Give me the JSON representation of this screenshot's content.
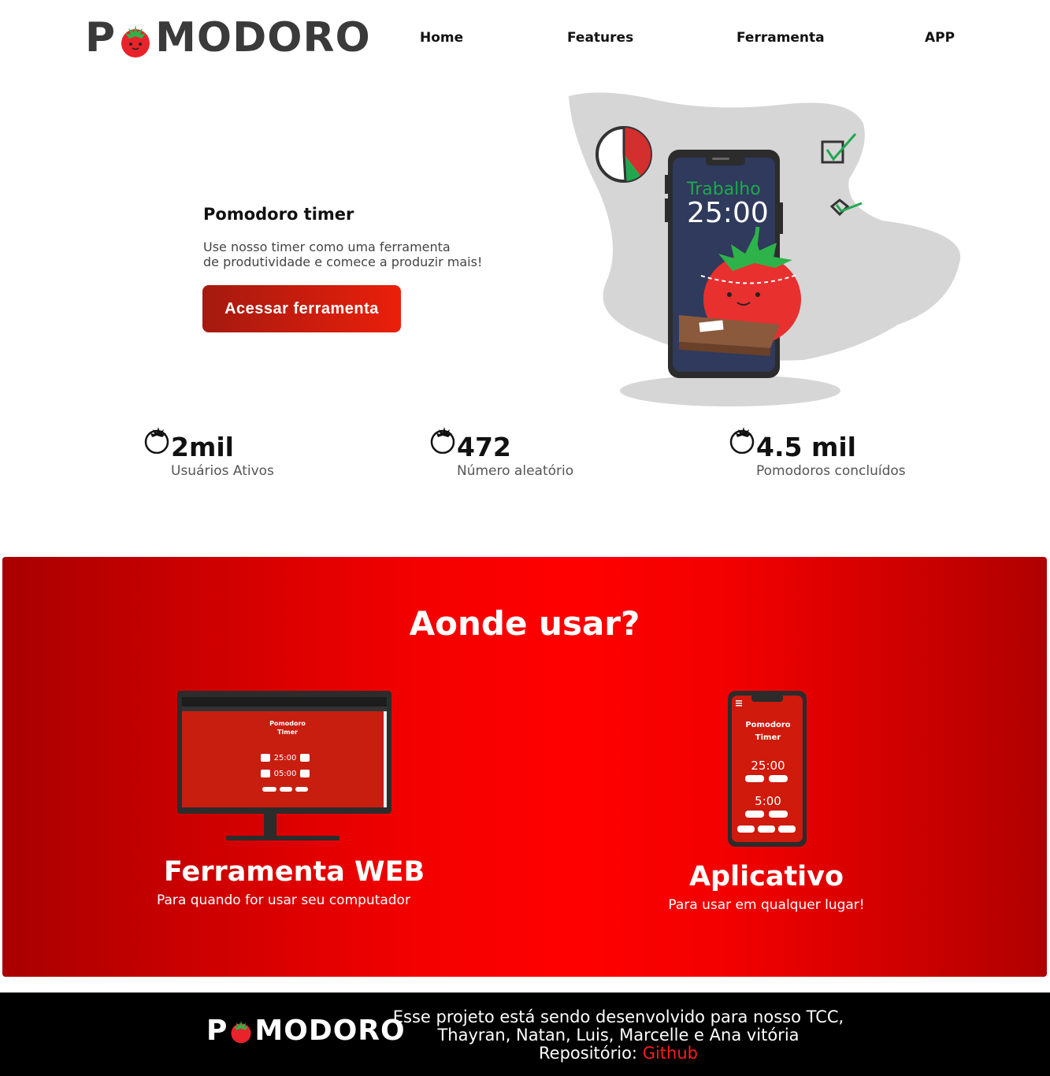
{
  "header": {
    "logo": {
      "left": "P",
      "right": "MODORO"
    },
    "nav": [
      {
        "label": "Home"
      },
      {
        "label": "Features"
      },
      {
        "label": "Ferramenta"
      },
      {
        "label": "APP"
      }
    ]
  },
  "hero": {
    "title": "Pomodoro timer",
    "text_line1": "Use nosso timer como uma ferramenta",
    "text_line2": "de produtividade e comece a produzir mais!",
    "button": "Acessar ferramenta",
    "phone_mode": "Trabalho",
    "phone_time": "25:00"
  },
  "stats": [
    {
      "value": "2mil",
      "label": "Usuários Ativos"
    },
    {
      "value": "472",
      "label": "Número aleatório"
    },
    {
      "value": "4.5 mil",
      "label": "Pomodoros concluídos"
    }
  ],
  "where": {
    "title": "Aonde usar?",
    "web": {
      "title": "Ferramenta WEB",
      "subtitle": "Para quando for usar seu computador",
      "screen_title_1": "Pomodoro",
      "screen_title_2": "Timer",
      "time_1": "25:00",
      "time_2": "05:00"
    },
    "app": {
      "title": "Aplicativo",
      "subtitle": "Para usar em qualquer lugar!",
      "screen_title_1": "Pomodoro",
      "screen_title_2": "Timer",
      "time_1": "25:00",
      "time_2": "5:00"
    }
  },
  "footer": {
    "logo": {
      "left": "P",
      "right": "MODORO"
    },
    "line1": "Esse projeto está sendo desenvolvido para nosso TCC,",
    "line2": "Thayran, Natan, Luis, Marcelle e Ana vitória",
    "repo_label": "Repositório: ",
    "repo_link": "Github"
  },
  "colors": {
    "brand_red": "#ea1f0b",
    "dark_red": "#a41a0f",
    "phone_green": "#1fa84f",
    "footer_bg": "#000000"
  }
}
